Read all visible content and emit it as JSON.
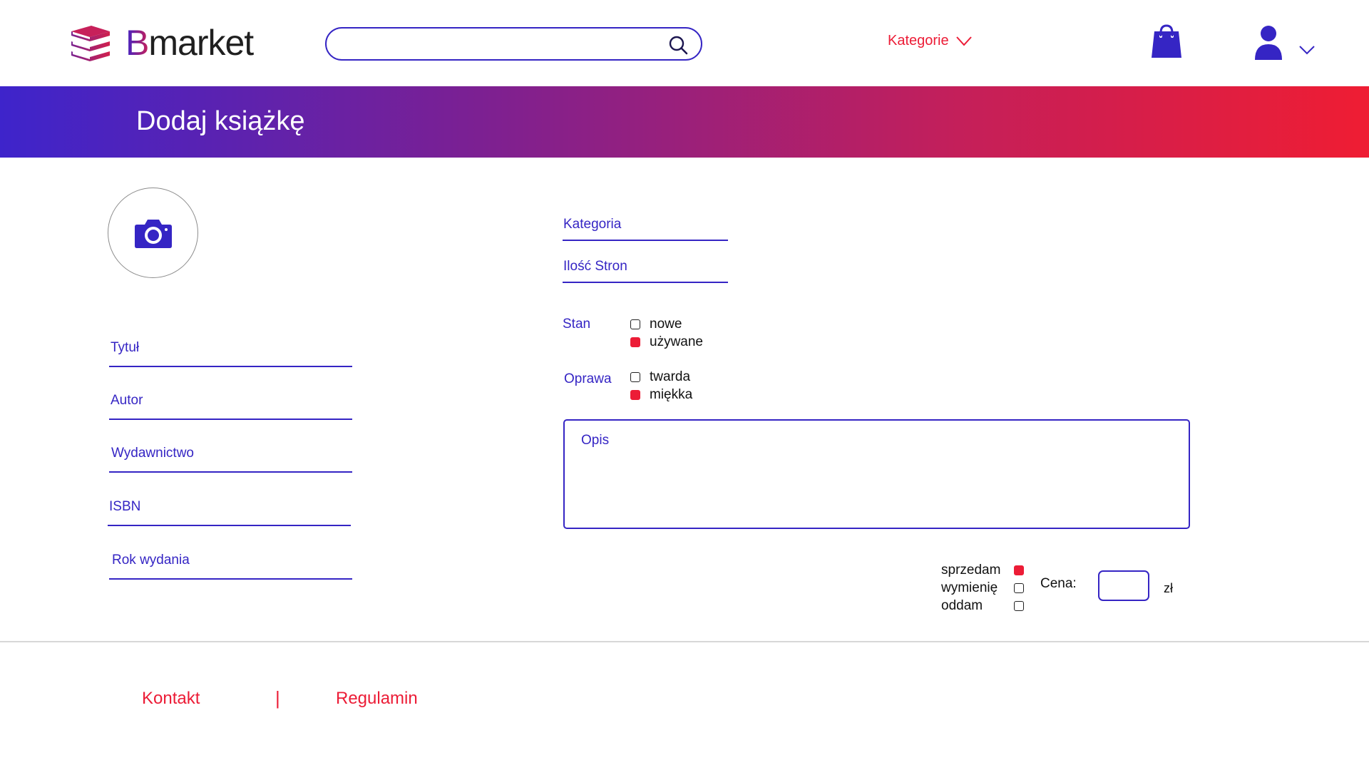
{
  "header": {
    "logo_letter": "B",
    "logo_rest": "market",
    "search_placeholder": "",
    "categories_label": "Kategorie"
  },
  "banner": {
    "title": "Dodaj książkę"
  },
  "form": {
    "left_fields": [
      "Tytuł",
      "Autor",
      "Wydawnictwo",
      "ISBN",
      "Rok wydania"
    ],
    "category_label": "Kategoria",
    "pages_label": "Ilość Stron",
    "condition": {
      "label": "Stan",
      "options": [
        {
          "label": "nowe",
          "checked": false
        },
        {
          "label": "używane",
          "checked": true
        }
      ]
    },
    "binding": {
      "label": "Oprawa",
      "options": [
        {
          "label": "twarda",
          "checked": false
        },
        {
          "label": "miękka",
          "checked": true
        }
      ]
    },
    "description_label": "Opis",
    "trade_options": [
      {
        "label": "sprzedam",
        "checked": true
      },
      {
        "label": "wymienię",
        "checked": false
      },
      {
        "label": "oddam",
        "checked": false
      }
    ],
    "price_label": "Cena:",
    "currency": "zł"
  },
  "footer": {
    "contact": "Kontakt",
    "separator": "|",
    "rules": "Regulamin"
  },
  "colors": {
    "primary": "#3525c4",
    "accent": "#ec1c36",
    "gradient_start": "#3e24cb",
    "gradient_end": "#ef1d33"
  },
  "icons": [
    "books-logo-icon",
    "search-icon",
    "chevron-down-icon",
    "shopping-bag-icon",
    "user-icon",
    "camera-icon"
  ]
}
